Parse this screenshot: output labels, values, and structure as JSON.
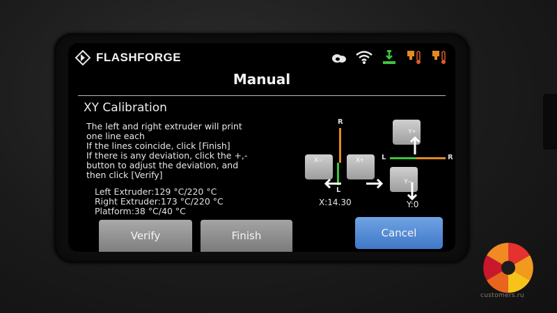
{
  "brand": {
    "name": "FLASHFORGE"
  },
  "status_icons": [
    "cloud-icon",
    "wifi-icon",
    "printer-status-icon",
    "left-extruder-temp-icon",
    "right-extruder-temp-icon"
  ],
  "screen": {
    "title": "Manual",
    "section_title": "XY Calibration",
    "instructions": [
      "The left and right extruder will print",
      "one line each",
      "If the lines coincide, click [Finish]",
      "If there is any deviation, click the +,-",
      "button to adjust the deviation, and",
      "then click [Verify]"
    ],
    "temps": [
      "Left Extruder:129 °C/220 °C",
      "Right Extruder:173 °C/220 °C",
      "Platform:38 °C/40 °C"
    ]
  },
  "calibration": {
    "x_axis": {
      "top_label": "R",
      "bottom_label": "L",
      "minus_label": "X−",
      "plus_label": "X+",
      "readout": "X:14.30"
    },
    "y_axis": {
      "left_label": "L",
      "right_label": "R",
      "plus_label": "Y+",
      "minus_label": "Y−",
      "readout": "Y:0"
    }
  },
  "buttons": {
    "verify": "Verify",
    "finish": "Finish",
    "cancel": "Cancel"
  },
  "watermark": {
    "text": "customers.ru"
  },
  "colors": {
    "green": "#3fc43f",
    "orange": "#e58a1f",
    "cancel": "#4a83d1"
  }
}
